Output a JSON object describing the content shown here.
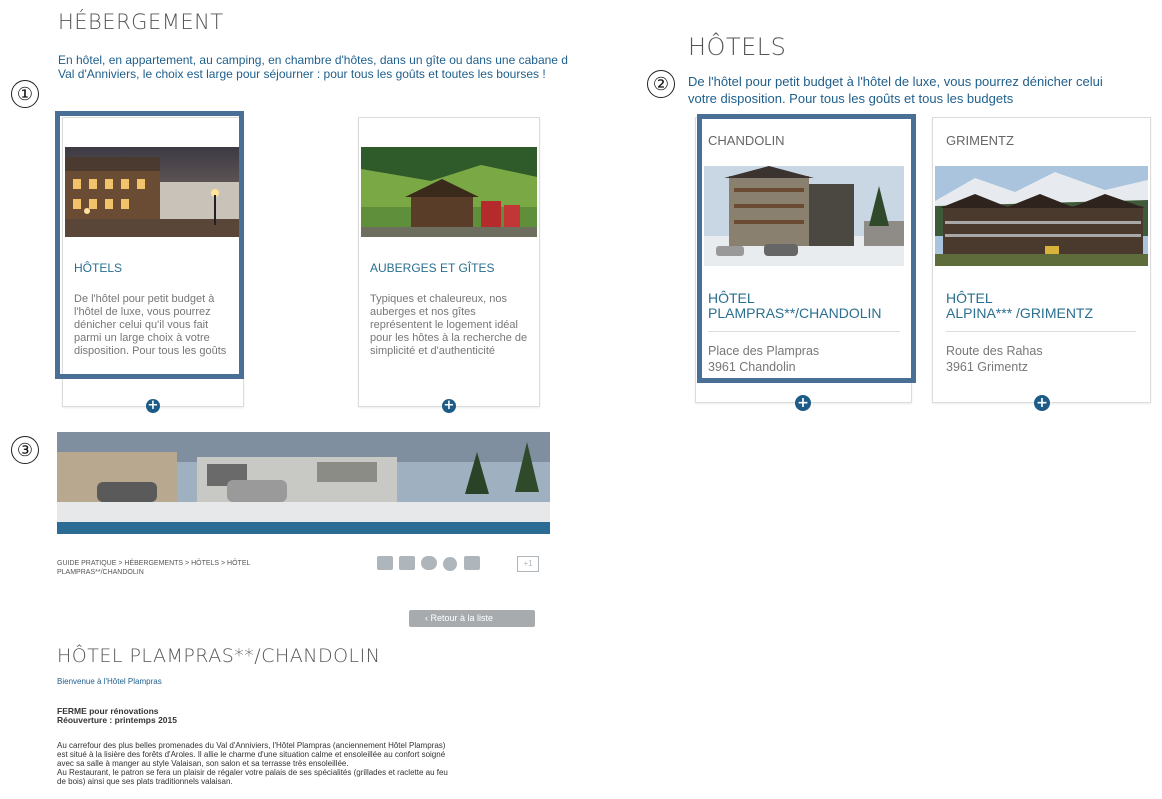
{
  "markers": [
    "①",
    "②",
    "③"
  ],
  "left": {
    "title": "HÉBERGEMENT",
    "intro_line1": "En hôtel, en appartement, au camping, en chambre d'hôtes, dans un gîte ou dans une cabane d",
    "intro_line2": "Val d'Anniviers, le choix est large pour séjourner : pour tous les goûts et toutes les bourses !",
    "cards": [
      {
        "title": "HÔTELS",
        "text": "De l'hôtel pour petit budget à l'hôtel de luxe, vous pourrez dénicher celui qu'il vous fait parmi un large choix à votre disposition. Pour tous les goûts",
        "plus": "+"
      },
      {
        "title": "AUBERGES ET GÎTES",
        "text": "Typiques et chaleureux, nos auberges et nos gîtes représentent le logement idéal pour les hôtes à la recherche de simplicité et d'authenticité",
        "plus": "+"
      }
    ]
  },
  "right": {
    "title": "HÔTELS",
    "intro_line1": "De l'hôtel pour petit budget à l'hôtel de luxe, vous pourrez dénicher celui",
    "intro_line2": "votre disposition. Pour tous les goûts et tous les budgets",
    "cards": [
      {
        "location": "CHANDOLIN",
        "name_line1": "HÔTEL",
        "name_line2": "PLAMPRAS**/CHANDOLIN",
        "addr1": "Place des Plampras",
        "addr2": "3961 Chandolin",
        "plus": "+"
      },
      {
        "location": "GRIMENTZ",
        "name_line1": "HÔTEL",
        "name_line2": "ALPINA*** /GRIMENTZ",
        "addr1": "Route des Rahas",
        "addr2": "3961 Grimentz",
        "plus": "+"
      }
    ]
  },
  "detail": {
    "breadcrumb_line1": "GUIDE PRATIQUE > HÉBERGEMENTS > HÔTELS > HÔTEL",
    "breadcrumb_line2": "PLAMPRAS**/CHANDOLIN",
    "back_button": "‹ Retour à la liste",
    "title": "HÔTEL PLAMPRAS**/CHANDOLIN",
    "welcome": "Bienvenue à l'Hôtel Plampras",
    "closed_line1": "FERME pour rénovations",
    "closed_line2": "Réouverture : printemps 2015",
    "para_line1": "Au carrefour des plus belles promenades du Val d'Anniviers, l'Hôtel Plampras (anciennement Hôtel Plampras)",
    "para_line2": "est situé à la lisière des forêts d'Aroles. Il allie le charme d'une situation calme et ensoleillée au confort soigné",
    "para_line3": "avec sa salle à manger au style Valaisan, son salon et sa terrasse très ensoleillée.",
    "para_line4": "Au Restaurant, le patron se fera un plaisir de régaler votre palais de ses spécialités (grillades et raclette au feu",
    "para_line5": "de bois) ainsi que ses plats traditionnels valaisan.",
    "share_badge": "+1"
  },
  "colors": {
    "accent": "#1d5c86",
    "highlight": "#4a6f96",
    "link": "#2a6f8f"
  }
}
